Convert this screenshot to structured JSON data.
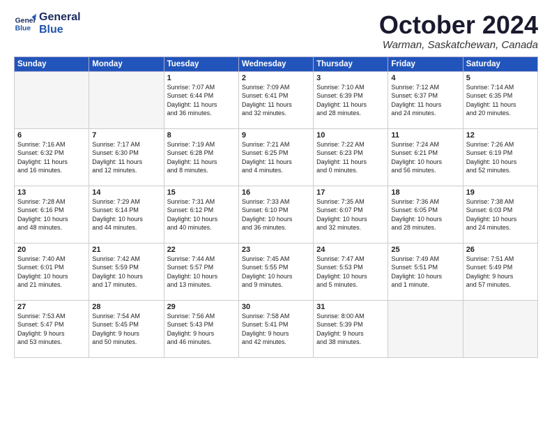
{
  "logo": {
    "line1": "General",
    "line2": "Blue"
  },
  "title": "October 2024",
  "location": "Warman, Saskatchewan, Canada",
  "days_of_week": [
    "Sunday",
    "Monday",
    "Tuesday",
    "Wednesday",
    "Thursday",
    "Friday",
    "Saturday"
  ],
  "weeks": [
    [
      {
        "day": "",
        "info": ""
      },
      {
        "day": "",
        "info": ""
      },
      {
        "day": "1",
        "info": "Sunrise: 7:07 AM\nSunset: 6:44 PM\nDaylight: 11 hours\nand 36 minutes."
      },
      {
        "day": "2",
        "info": "Sunrise: 7:09 AM\nSunset: 6:41 PM\nDaylight: 11 hours\nand 32 minutes."
      },
      {
        "day": "3",
        "info": "Sunrise: 7:10 AM\nSunset: 6:39 PM\nDaylight: 11 hours\nand 28 minutes."
      },
      {
        "day": "4",
        "info": "Sunrise: 7:12 AM\nSunset: 6:37 PM\nDaylight: 11 hours\nand 24 minutes."
      },
      {
        "day": "5",
        "info": "Sunrise: 7:14 AM\nSunset: 6:35 PM\nDaylight: 11 hours\nand 20 minutes."
      }
    ],
    [
      {
        "day": "6",
        "info": "Sunrise: 7:16 AM\nSunset: 6:32 PM\nDaylight: 11 hours\nand 16 minutes."
      },
      {
        "day": "7",
        "info": "Sunrise: 7:17 AM\nSunset: 6:30 PM\nDaylight: 11 hours\nand 12 minutes."
      },
      {
        "day": "8",
        "info": "Sunrise: 7:19 AM\nSunset: 6:28 PM\nDaylight: 11 hours\nand 8 minutes."
      },
      {
        "day": "9",
        "info": "Sunrise: 7:21 AM\nSunset: 6:25 PM\nDaylight: 11 hours\nand 4 minutes."
      },
      {
        "day": "10",
        "info": "Sunrise: 7:22 AM\nSunset: 6:23 PM\nDaylight: 11 hours\nand 0 minutes."
      },
      {
        "day": "11",
        "info": "Sunrise: 7:24 AM\nSunset: 6:21 PM\nDaylight: 10 hours\nand 56 minutes."
      },
      {
        "day": "12",
        "info": "Sunrise: 7:26 AM\nSunset: 6:19 PM\nDaylight: 10 hours\nand 52 minutes."
      }
    ],
    [
      {
        "day": "13",
        "info": "Sunrise: 7:28 AM\nSunset: 6:16 PM\nDaylight: 10 hours\nand 48 minutes."
      },
      {
        "day": "14",
        "info": "Sunrise: 7:29 AM\nSunset: 6:14 PM\nDaylight: 10 hours\nand 44 minutes."
      },
      {
        "day": "15",
        "info": "Sunrise: 7:31 AM\nSunset: 6:12 PM\nDaylight: 10 hours\nand 40 minutes."
      },
      {
        "day": "16",
        "info": "Sunrise: 7:33 AM\nSunset: 6:10 PM\nDaylight: 10 hours\nand 36 minutes."
      },
      {
        "day": "17",
        "info": "Sunrise: 7:35 AM\nSunset: 6:07 PM\nDaylight: 10 hours\nand 32 minutes."
      },
      {
        "day": "18",
        "info": "Sunrise: 7:36 AM\nSunset: 6:05 PM\nDaylight: 10 hours\nand 28 minutes."
      },
      {
        "day": "19",
        "info": "Sunrise: 7:38 AM\nSunset: 6:03 PM\nDaylight: 10 hours\nand 24 minutes."
      }
    ],
    [
      {
        "day": "20",
        "info": "Sunrise: 7:40 AM\nSunset: 6:01 PM\nDaylight: 10 hours\nand 21 minutes."
      },
      {
        "day": "21",
        "info": "Sunrise: 7:42 AM\nSunset: 5:59 PM\nDaylight: 10 hours\nand 17 minutes."
      },
      {
        "day": "22",
        "info": "Sunrise: 7:44 AM\nSunset: 5:57 PM\nDaylight: 10 hours\nand 13 minutes."
      },
      {
        "day": "23",
        "info": "Sunrise: 7:45 AM\nSunset: 5:55 PM\nDaylight: 10 hours\nand 9 minutes."
      },
      {
        "day": "24",
        "info": "Sunrise: 7:47 AM\nSunset: 5:53 PM\nDaylight: 10 hours\nand 5 minutes."
      },
      {
        "day": "25",
        "info": "Sunrise: 7:49 AM\nSunset: 5:51 PM\nDaylight: 10 hours\nand 1 minute."
      },
      {
        "day": "26",
        "info": "Sunrise: 7:51 AM\nSunset: 5:49 PM\nDaylight: 9 hours\nand 57 minutes."
      }
    ],
    [
      {
        "day": "27",
        "info": "Sunrise: 7:53 AM\nSunset: 5:47 PM\nDaylight: 9 hours\nand 53 minutes."
      },
      {
        "day": "28",
        "info": "Sunrise: 7:54 AM\nSunset: 5:45 PM\nDaylight: 9 hours\nand 50 minutes."
      },
      {
        "day": "29",
        "info": "Sunrise: 7:56 AM\nSunset: 5:43 PM\nDaylight: 9 hours\nand 46 minutes."
      },
      {
        "day": "30",
        "info": "Sunrise: 7:58 AM\nSunset: 5:41 PM\nDaylight: 9 hours\nand 42 minutes."
      },
      {
        "day": "31",
        "info": "Sunrise: 8:00 AM\nSunset: 5:39 PM\nDaylight: 9 hours\nand 38 minutes."
      },
      {
        "day": "",
        "info": ""
      },
      {
        "day": "",
        "info": ""
      }
    ]
  ]
}
